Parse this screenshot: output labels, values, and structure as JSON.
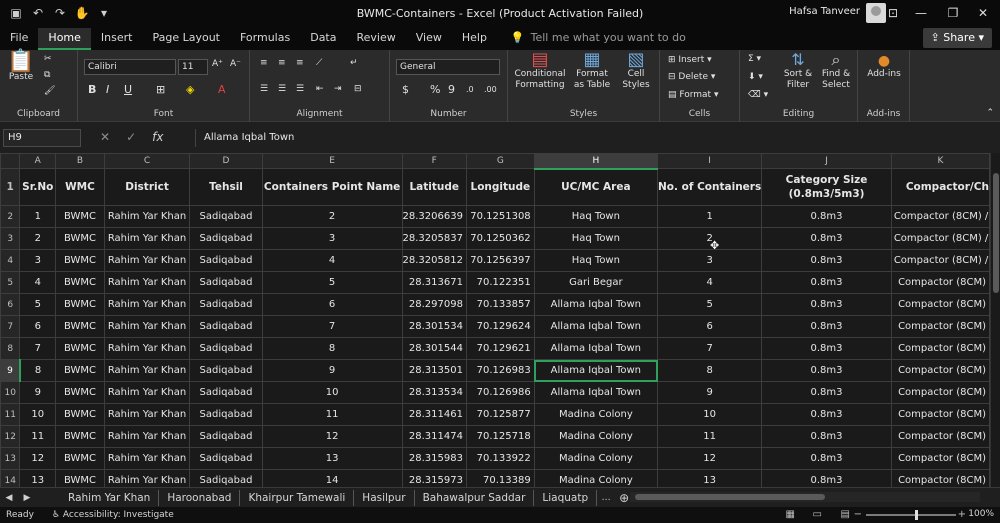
{
  "window": {
    "title": "BWMC-Containers  -  Excel (Product Activation Failed)",
    "user": "Hafsa Tanveer",
    "share_label": "Share"
  },
  "tabs": [
    {
      "label": "File"
    },
    {
      "label": "Home"
    },
    {
      "label": "Insert"
    },
    {
      "label": "Page Layout"
    },
    {
      "label": "Formulas"
    },
    {
      "label": "Data"
    },
    {
      "label": "Review"
    },
    {
      "label": "View"
    },
    {
      "label": "Help"
    }
  ],
  "tellme": "Tell me what you want to do",
  "ribbon": {
    "clipboard": {
      "paste": "Paste",
      "label": "Clipboard"
    },
    "font": {
      "name": "Calibri",
      "size": "11",
      "label": "Font"
    },
    "alignment": {
      "label": "Alignment"
    },
    "number": {
      "format": "General",
      "label": "Number"
    },
    "styles": {
      "conditional": "Conditional Formatting",
      "format_table": "Format as Table",
      "cell_styles": "Cell Styles",
      "label": "Styles"
    },
    "cells": {
      "insert": "Insert",
      "delete": "Delete",
      "format": "Format",
      "label": "Cells"
    },
    "editing": {
      "sort": "Sort & Filter",
      "find": "Find & Select",
      "label": "Editing"
    },
    "addins": {
      "button": "Add-ins",
      "label": "Add-ins"
    }
  },
  "formula_bar": {
    "name_box": "H9",
    "formula": "Allama Iqbal Town"
  },
  "columns": [
    "A",
    "B",
    "C",
    "D",
    "E",
    "F",
    "G",
    "H",
    "I",
    "J",
    "K"
  ],
  "header_row": [
    "Sr.No",
    "WMC",
    "District",
    "Tehsil",
    "Containers Point Name",
    "Latitude",
    "Longitude",
    "UC/MC Area",
    "No. of Containers",
    "Category Size (0.8m3/5m3)",
    "Compactor/Ch"
  ],
  "rows": [
    {
      "n": "2",
      "c": [
        "1",
        "BWMC",
        "Rahim Yar Khan",
        "Sadiqabad",
        "2",
        "28.3206639",
        "70.1251308",
        "Haq Town",
        "1",
        "0.8m3",
        "Compactor (8CM) /"
      ]
    },
    {
      "n": "3",
      "c": [
        "2",
        "BWMC",
        "Rahim Yar Khan",
        "Sadiqabad",
        "3",
        "28.3205837",
        "70.1250362",
        "Haq Town",
        "2",
        "0.8m3",
        "Compactor (8CM) /"
      ]
    },
    {
      "n": "4",
      "c": [
        "3",
        "BWMC",
        "Rahim Yar Khan",
        "Sadiqabad",
        "4",
        "28.3205812",
        "70.1256397",
        "Haq Town",
        "3",
        "0.8m3",
        "Compactor (8CM) /"
      ]
    },
    {
      "n": "5",
      "c": [
        "4",
        "BWMC",
        "Rahim Yar Khan",
        "Sadiqabad",
        "5",
        "28.313671",
        "70.122351",
        "Gari Begar",
        "4",
        "0.8m3",
        "Compactor (8CM)"
      ]
    },
    {
      "n": "6",
      "c": [
        "5",
        "BWMC",
        "Rahim Yar Khan",
        "Sadiqabad",
        "6",
        "28.297098",
        "70.133857",
        "Allama Iqbal Town",
        "5",
        "0.8m3",
        "Compactor (8CM)"
      ]
    },
    {
      "n": "7",
      "c": [
        "6",
        "BWMC",
        "Rahim Yar Khan",
        "Sadiqabad",
        "7",
        "28.301534",
        "70.129624",
        "Allama Iqbal Town",
        "6",
        "0.8m3",
        "Compactor (8CM)"
      ]
    },
    {
      "n": "8",
      "c": [
        "7",
        "BWMC",
        "Rahim Yar Khan",
        "Sadiqabad",
        "8",
        "28.301544",
        "70.129621",
        "Allama Iqbal Town",
        "7",
        "0.8m3",
        "Compactor (8CM)"
      ]
    },
    {
      "n": "9",
      "c": [
        "8",
        "BWMC",
        "Rahim Yar Khan",
        "Sadiqabad",
        "9",
        "28.313501",
        "70.126983",
        "Allama Iqbal Town",
        "8",
        "0.8m3",
        "Compactor (8CM)"
      ]
    },
    {
      "n": "10",
      "c": [
        "9",
        "BWMC",
        "Rahim Yar Khan",
        "Sadiqabad",
        "10",
        "28.313534",
        "70.126986",
        "Allama Iqbal Town",
        "9",
        "0.8m3",
        "Compactor (8CM)"
      ]
    },
    {
      "n": "11",
      "c": [
        "10",
        "BWMC",
        "Rahim Yar Khan",
        "Sadiqabad",
        "11",
        "28.311461",
        "70.125877",
        "Madina Colony",
        "10",
        "0.8m3",
        "Compactor (8CM)"
      ]
    },
    {
      "n": "12",
      "c": [
        "11",
        "BWMC",
        "Rahim Yar Khan",
        "Sadiqabad",
        "12",
        "28.311474",
        "70.125718",
        "Madina Colony",
        "11",
        "0.8m3",
        "Compactor (8CM)"
      ]
    },
    {
      "n": "13",
      "c": [
        "12",
        "BWMC",
        "Rahim Yar Khan",
        "Sadiqabad",
        "13",
        "28.315983",
        "70.133922",
        "Madina Colony",
        "12",
        "0.8m3",
        "Compactor (8CM)"
      ]
    },
    {
      "n": "14",
      "c": [
        "13",
        "BWMC",
        "Rahim Yar Khan",
        "Sadiqabad",
        "14",
        "28.315973",
        "70.13389",
        "Madina Colony",
        "13",
        "0.8m3",
        "Compactor (8CM)"
      ]
    }
  ],
  "sheet_tabs": [
    "Rahim Yar Khan",
    "Haroonabad",
    "Khairpur Tamewali",
    "Hasilpur",
    "Bahawalpur Saddar",
    "Liaquatp"
  ],
  "status": {
    "ready": "Ready",
    "accessibility": "Accessibility: Investigate",
    "zoom": "100%"
  },
  "colors": {
    "accent": "#2fa05c",
    "background": "#1f1f1f"
  }
}
